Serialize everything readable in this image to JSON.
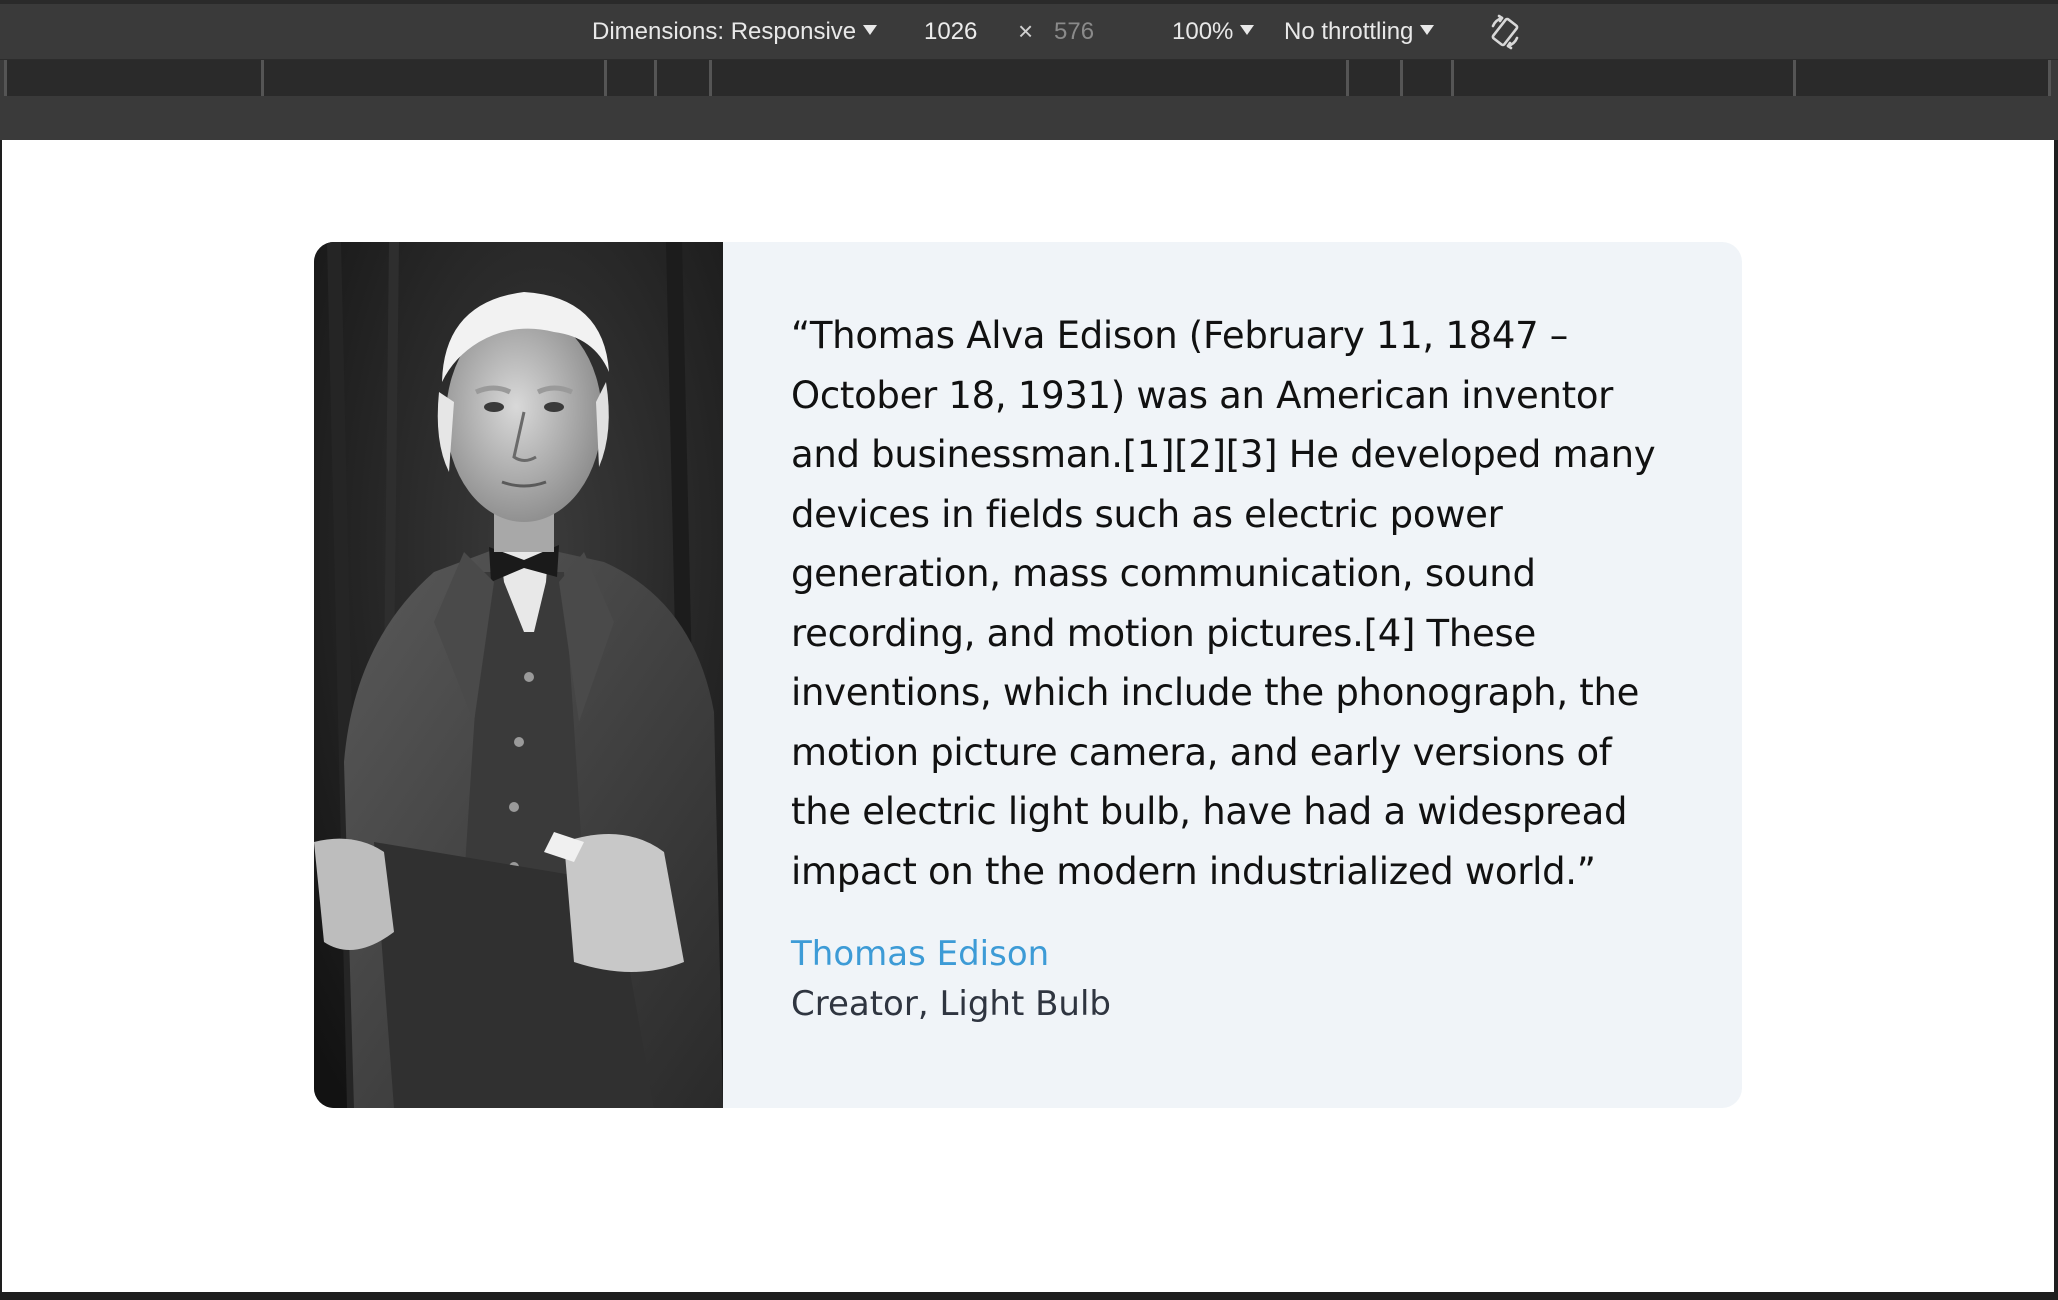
{
  "devtools": {
    "dimensions_label": "Dimensions: Responsive",
    "width": "1026",
    "times": "×",
    "height_placeholder": "576",
    "zoom": "100%",
    "throttling": "No throttling",
    "rotate_icon": "rotate-icon"
  },
  "testimonial": {
    "quote": "“Thomas Alva Edison (February 11, 1847 – October 18, 1931) was an American inventor and businessman.[1][2][3] He developed many devices in fields such as electric power generation, mass communication, sound recording, and motion pictures.[4] These inventions, which include the phonograph, the motion picture camera, and early versions of the electric light bulb, have had a widespread impact on the modern industrialized world.”",
    "author_name": "Thomas Edison",
    "author_title": "Creator, Light Bulb",
    "photo": "portrait-photo"
  },
  "colors": {
    "card_background": "#f0f4f8",
    "author_name": "#3d9bd6",
    "toolbar_background": "#3a3a3a"
  }
}
